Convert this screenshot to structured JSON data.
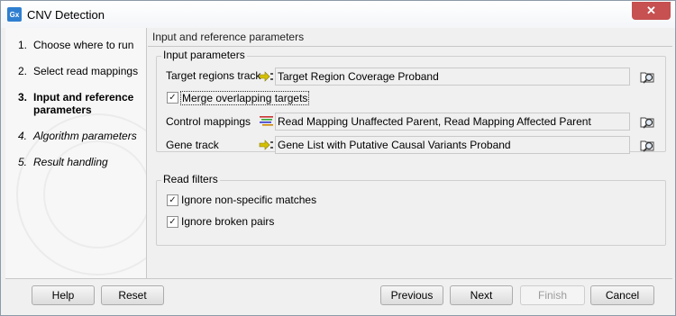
{
  "window": {
    "title": "CNV Detection",
    "app_icon": "Gx",
    "close_symbol": "✕"
  },
  "steps": [
    {
      "num": "1.",
      "label": "Choose where to run"
    },
    {
      "num": "2.",
      "label": "Select read mappings"
    },
    {
      "num": "3.",
      "label": "Input and reference parameters"
    },
    {
      "num": "4.",
      "label": "Algorithm parameters"
    },
    {
      "num": "5.",
      "label": "Result handling"
    }
  ],
  "main": {
    "header": "Input and reference parameters",
    "input_group": {
      "title": "Input parameters",
      "target_regions": {
        "label": "Target regions track",
        "value": "Target Region Coverage Proband"
      },
      "merge": {
        "label": "Merge overlapping targets",
        "checked": true
      },
      "control_mappings": {
        "label": "Control mappings",
        "value": "Read Mapping Unaffected Parent, Read Mapping Affected Parent"
      },
      "gene_track": {
        "label": "Gene track",
        "value": "Gene List with Putative Causal Variants Proband"
      }
    },
    "read_filters": {
      "title": "Read filters",
      "nonspecific": {
        "label": "Ignore non-specific matches",
        "checked": true
      },
      "broken_pairs": {
        "label": "Ignore broken pairs",
        "checked": true
      }
    }
  },
  "buttons": {
    "help": "Help",
    "reset": "Reset",
    "previous": "Previous",
    "next": "Next",
    "finish": "Finish",
    "cancel": "Cancel"
  },
  "icons": {
    "track": "track-icon",
    "mapping": "read-mapping-icon",
    "browse": "browse-folder-icon",
    "check": "✓"
  },
  "colors": {
    "title_close": "#c75050",
    "app_icon": "#2f7fd0",
    "track_icon": "#d4c000"
  }
}
